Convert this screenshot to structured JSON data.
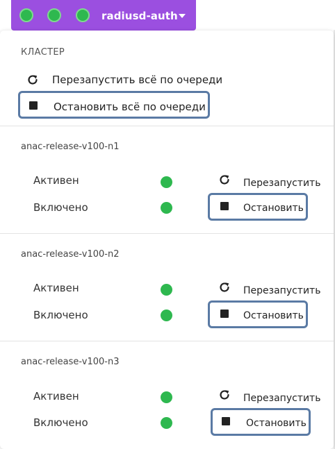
{
  "header": {
    "title": "radiusd-auth",
    "status_dots": [
      "running",
      "running",
      "running"
    ],
    "accent_color": "#9b4fe0",
    "status_color": "#2eb84f"
  },
  "cluster": {
    "section_title": "КЛАСТЕР",
    "restart_all_label": "Перезапустить всё по очереди",
    "stop_all_label": "Остановить всё по очереди",
    "restart_icon": "restart-icon",
    "stop_icon": "stop-icon"
  },
  "nodes": [
    {
      "name": "anac-release-v100-n1",
      "active_label": "Активен",
      "enabled_label": "Включено",
      "restart_label": "Перезапустить",
      "stop_label": "Остановить"
    },
    {
      "name": "anac-release-v100-n2",
      "active_label": "Активен",
      "enabled_label": "Включено",
      "restart_label": "Перезапустить",
      "stop_label": "Остановить"
    },
    {
      "name": "anac-release-v100-n3",
      "active_label": "Активен",
      "enabled_label": "Включено",
      "restart_label": "Перезапустить",
      "stop_label": "Остановить"
    }
  ]
}
